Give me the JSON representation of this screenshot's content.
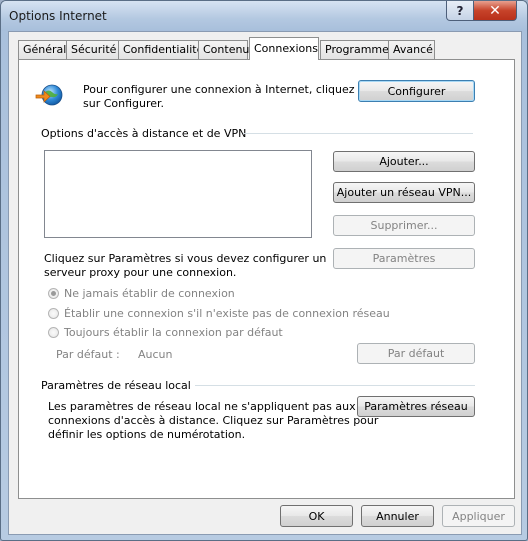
{
  "window": {
    "title": "Options Internet",
    "help_glyph": "?",
    "close_glyph": "✕"
  },
  "tabs": [
    {
      "label": "Général"
    },
    {
      "label": "Sécurité"
    },
    {
      "label": "Confidentialité"
    },
    {
      "label": "Contenu"
    },
    {
      "label": "Connexions",
      "active": true
    },
    {
      "label": "Programmes"
    },
    {
      "label": "Avancé"
    }
  ],
  "setup": {
    "text_line1": "Pour configurer une connexion à Internet, cliquez",
    "text_line2": "sur Configurer.",
    "button": "Configurer",
    "icon": "globe-network-icon"
  },
  "dialup": {
    "section_title": "Options d'accès à distance et de VPN",
    "add_button": "Ajouter...",
    "add_vpn_button": "Ajouter un réseau VPN...",
    "remove_button": "Supprimer...",
    "settings_button": "Paramètres",
    "proxy_text_line1": "Cliquez sur Paramètres si vous devez configurer un",
    "proxy_text_line2": "serveur proxy pour une connexion.",
    "radio_never": "Ne jamais établir de connexion",
    "radio_when_no_network": "Établir une connexion s'il n'existe pas de connexion réseau",
    "radio_always": "Toujours établir la connexion par défaut",
    "default_label": "Par défaut :",
    "default_value": "Aucun",
    "set_default_button": "Par défaut"
  },
  "lan": {
    "section_title": "Paramètres de réseau local",
    "text_line1": "Les paramètres de réseau local ne s'appliquent pas aux",
    "text_line2": "connexions d'accès à distance. Cliquez sur Paramètres pour",
    "text_line3": "définir les options de numérotation.",
    "button": "Paramètres réseau"
  },
  "footer": {
    "ok": "OK",
    "cancel": "Annuler",
    "apply": "Appliquer"
  }
}
